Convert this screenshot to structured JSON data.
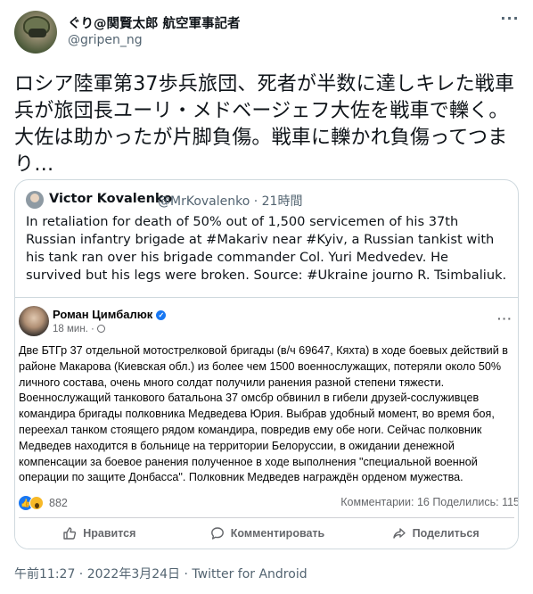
{
  "tweet": {
    "author_name": "ぐり@関賢太郎 航空軍事記者",
    "author_handle": "@gripen_ng",
    "text": "ロシア陸軍第37歩兵旅団、死者が半数に達しキレた戦車兵が旅団長ユーリ・メドベージェフ大佐を戦車で轢く。大佐は助かったが片脚負傷。戦車に轢かれ負傷ってつまり…",
    "timestamp": "午前11:27 · 2022年3月24日 · Twitter for Android"
  },
  "quote": {
    "author_name": "Victor Kovalenko",
    "author_handle": "@MrKovalenko · 21時間",
    "text": "In retaliation for death of 50% out of 1,500 servicemen of his 37th Russian infantry brigade at #Makariv near #Kyiv, a Russian tankist with his tank ran over his brigade commander Col. Yuri Medvedev. He survived but his legs were broken. Source: #Ukraine journo R. Tsimbaliuk."
  },
  "embedded_post": {
    "author_name": "Роман Цимбалюк",
    "time": "18 мин. ·",
    "text": "Две БТГр 37 отдельной мотострелковой бригады (в/ч 69647, Кяхта) в ходе боевых действий в районе Макарова (Киевская обл.) из более чем 1500 военнослужащих, потеряли около 50% личного состава, очень много солдат получили ранения разной степени тяжести. Военнослужащий танкового батальона 37 омсбр обвинил в гибели друзей-сослуживцев командира бригады полковника Медведева Юрия. Выбрав удобный момент, во время боя, переехал танком стоящего рядом командира, повредив ему обе ноги. Сейчас полковник Медведев находится в больнице на территории Белоруссии, в ожидании денежной компенсации за боевое ранения полученное в ходе выполнения \"специальной военной операции по защите Донбасса\". Полковник Медведев награждён орденом мужества.",
    "reaction_count": "882",
    "stats": "Комментарии: 16  Поделились: 115",
    "actions": {
      "like": "Нравится",
      "comment": "Комментировать",
      "share": "Поделиться"
    },
    "colors": {
      "accent": "#1877f2",
      "secondary_text": "#65676b"
    }
  },
  "colors": {
    "text": "#0f1419",
    "secondary": "#536471",
    "border": "#cfd9de"
  }
}
